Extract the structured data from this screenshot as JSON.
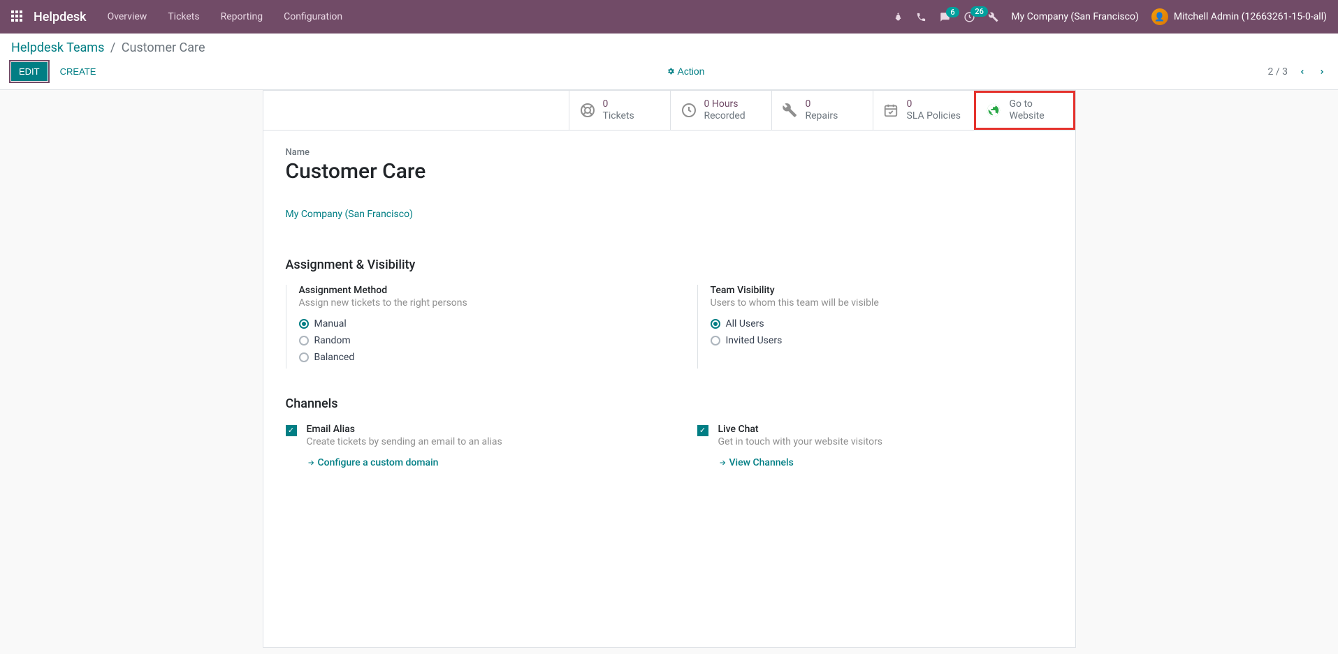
{
  "navbar": {
    "brand": "Helpdesk",
    "links": [
      "Overview",
      "Tickets",
      "Reporting",
      "Configuration"
    ],
    "messages_badge": "6",
    "activities_badge": "26",
    "company": "My Company (San Francisco)",
    "user": "Mitchell Admin (12663261-15-0-all)"
  },
  "breadcrumb": {
    "parent": "Helpdesk Teams",
    "current": "Customer Care"
  },
  "buttons": {
    "edit": "Edit",
    "create": "Create",
    "action": "Action"
  },
  "pager": {
    "text": "2 / 3"
  },
  "stats": {
    "tickets_val": "0",
    "tickets_label": "Tickets",
    "hours_val": "0 Hours",
    "hours_label": "Recorded",
    "repairs_val": "0",
    "repairs_label": "Repairs",
    "sla_val": "0",
    "sla_label": "SLA Policies",
    "website_line1": "Go to",
    "website_line2": "Website"
  },
  "form": {
    "name_label": "Name",
    "name_value": "Customer Care",
    "company_link": "My Company (San Francisco)",
    "section_assignment": "Assignment & Visibility",
    "assignment": {
      "title": "Assignment Method",
      "desc": "Assign new tickets to the right persons",
      "options": [
        "Manual",
        "Random",
        "Balanced"
      ]
    },
    "visibility": {
      "title": "Team Visibility",
      "desc": "Users to whom this team will be visible",
      "options": [
        "All Users",
        "Invited Users"
      ]
    },
    "section_channels": "Channels",
    "email_alias": {
      "title": "Email Alias",
      "desc": "Create tickets by sending an email to an alias",
      "link": "Configure a custom domain"
    },
    "live_chat": {
      "title": "Live Chat",
      "desc": "Get in touch with your website visitors",
      "link": "View Channels"
    }
  }
}
